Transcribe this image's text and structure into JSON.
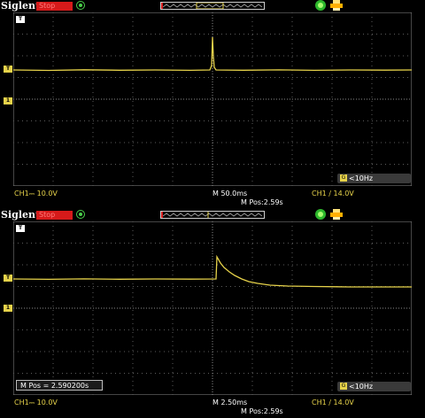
{
  "panels": [
    {
      "brand": "Siglent",
      "run_state": "Stop",
      "freq_readout": "<10Hz",
      "ch1_scale": "CH1⎓ 10.0V",
      "timebase": "M 50.0ms",
      "trigger_status": "CH1 ∕ 14.0V",
      "mpos_status": "M Pos:2.59s",
      "mpos_box": "",
      "trace_color": "#e6d24a",
      "grid_color": "#8a8a8a"
    },
    {
      "brand": "Siglent",
      "run_state": "Stop",
      "freq_readout": "<10Hz",
      "ch1_scale": "CH1⎓ 10.0V",
      "timebase": "M 2.50ms",
      "trigger_status": "CH1 ∕ 14.0V",
      "mpos_status": "M Pos:2.59s",
      "mpos_box": "M Pos = 2.590200s",
      "trace_color": "#e6d24a",
      "grid_color": "#8a8a8a"
    }
  ],
  "icons": {
    "trigger_status_icon": "trigger-icon",
    "memory_bar_icon": "memory-waveform-icon",
    "usb_icon": "usb-icon",
    "printer_icon": "printer-icon",
    "trigger_level_marker": "T",
    "channel_marker": "1",
    "trigger_position_marker": "T",
    "freq_icon": "G"
  }
}
